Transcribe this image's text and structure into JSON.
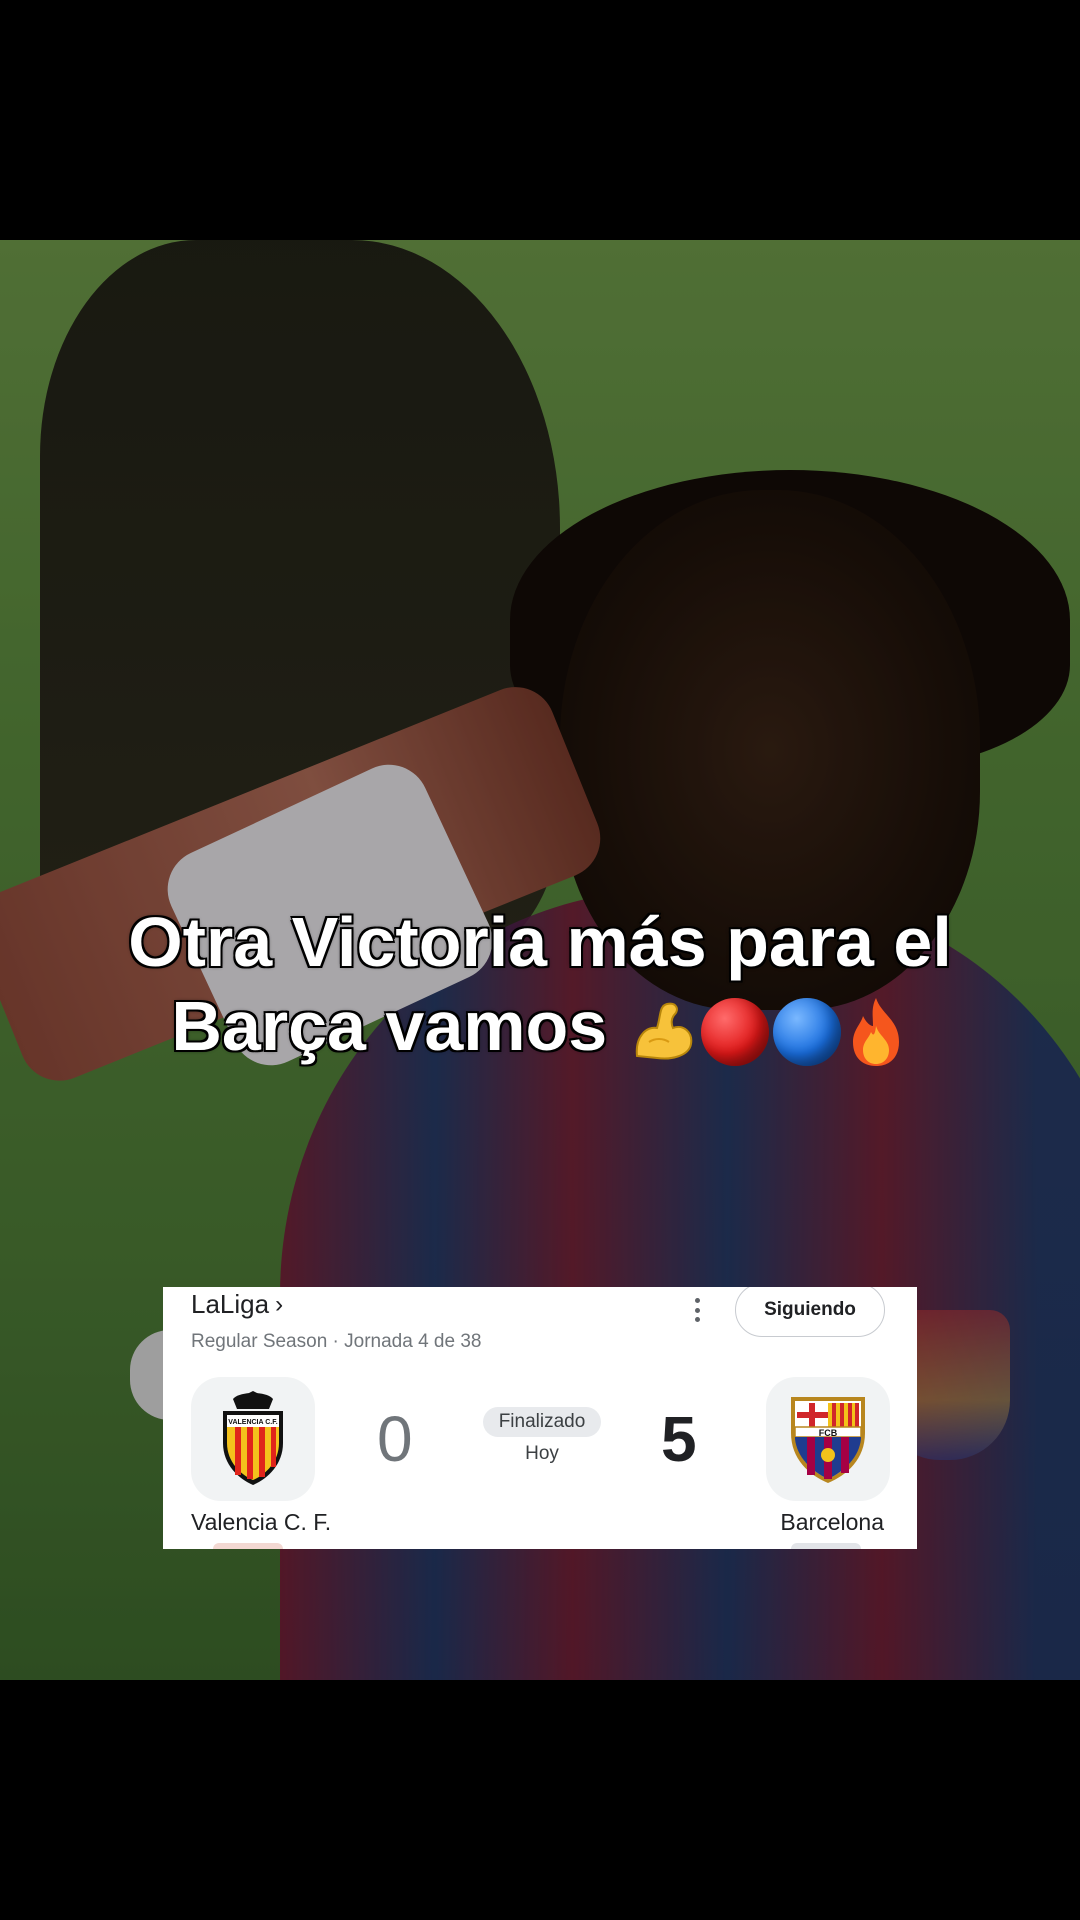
{
  "caption": {
    "line1": "Otra Victoria más para el",
    "line2": "Barça vamos"
  },
  "emojis": [
    "flexed-biceps",
    "red-circle",
    "blue-circle",
    "fire"
  ],
  "score_card": {
    "league": "LaLiga",
    "league_chevron": "›",
    "season_info": "Regular Season · Jornada 4 de 38",
    "follow_button": "Siguiendo",
    "status": "Finalizado",
    "date": "Hoy",
    "home_team": {
      "name": "Valencia C. F.",
      "score": "0"
    },
    "away_team": {
      "name": "Barcelona",
      "score": "5"
    }
  },
  "crest_text": {
    "valencia": "VALENCIA C.F.",
    "barcelona": "FCB"
  },
  "colors": {
    "barca_blue": "#1f3c8f",
    "barca_red": "#a50044",
    "valencia_orange": "#ee7b1f",
    "card_bg": "#ffffff"
  }
}
